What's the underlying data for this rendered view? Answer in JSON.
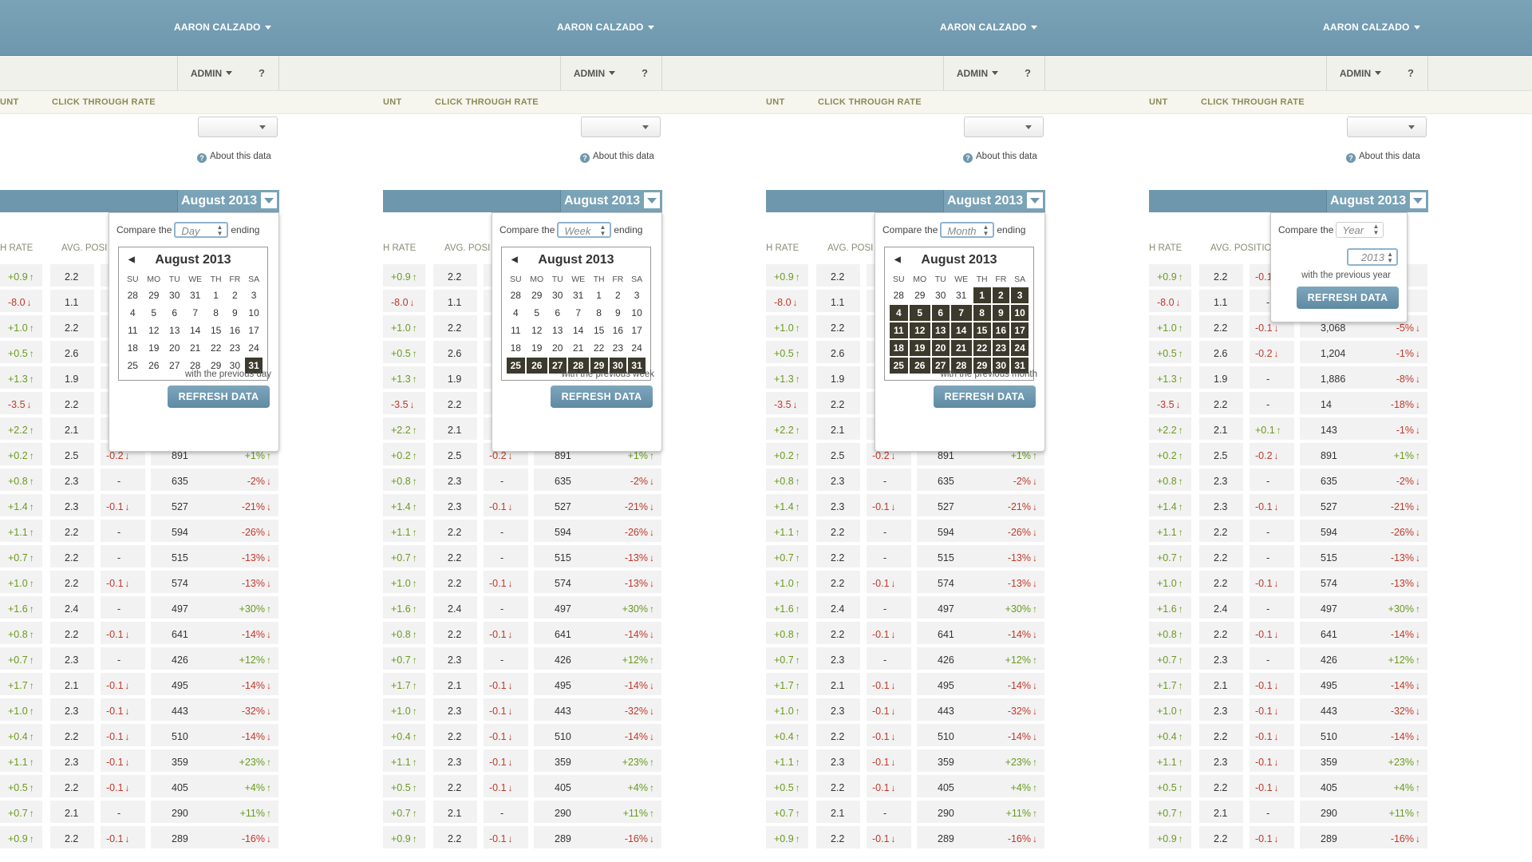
{
  "user_menu": "AARON CALZADO",
  "admin": "ADMIN",
  "help": "?",
  "col_count": "UNT",
  "col_ctr": "CLICK THROUGH RATE",
  "about": "About this data",
  "month_label": "August 2013",
  "compare_prefix": "Compare the",
  "compare_suffix": "ending",
  "sub_headers": {
    "rate": "H RATE",
    "pos": "AVG. POSI",
    "pos_full": "AVG. POSITION"
  },
  "calendar": {
    "title": "August 2013",
    "weekdays": [
      "SU",
      "MO",
      "TU",
      "WE",
      "TH",
      "FR",
      "SA"
    ],
    "weeks": [
      [
        28,
        29,
        30,
        31,
        1,
        2,
        3
      ],
      [
        4,
        5,
        6,
        7,
        8,
        9,
        10
      ],
      [
        11,
        12,
        13,
        14,
        15,
        16,
        17
      ],
      [
        18,
        19,
        20,
        21,
        22,
        23,
        24
      ],
      [
        25,
        26,
        27,
        28,
        29,
        30,
        31
      ]
    ]
  },
  "panels": [
    {
      "period": "Day",
      "with_previous": "with the previous day"
    },
    {
      "period": "Week",
      "with_previous": "with the previous week"
    },
    {
      "period": "Month",
      "with_previous": "with the previous month"
    },
    {
      "period": "Year",
      "year": "2013",
      "with_previous": "with the previous year"
    }
  ],
  "refresh": "REFRESH DATA",
  "rows": [
    {
      "rate": "+0.9",
      "pos": "2.2",
      "posch": "-0.1",
      "imp": "",
      "impch": ""
    },
    {
      "rate": "-8.0",
      "pos": "1.1",
      "posch": "-",
      "imp": "",
      "impch": ""
    },
    {
      "rate": "+1.0",
      "pos": "2.2",
      "posch": "-0.1",
      "imp": "3,068",
      "impch": "-5%"
    },
    {
      "rate": "+0.5",
      "pos": "2.6",
      "posch": "-0.2",
      "imp": "1,204",
      "impch": "-1%"
    },
    {
      "rate": "+1.3",
      "pos": "1.9",
      "posch": "-",
      "imp": "1,886",
      "impch": "-8%"
    },
    {
      "rate": "-3.5",
      "pos": "2.2",
      "posch": "-",
      "imp": "14",
      "impch": "-18%"
    },
    {
      "rate": "+2.2",
      "pos": "2.1",
      "posch": "+0.1",
      "imp": "143",
      "impch": "-1%"
    },
    {
      "rate": "+0.2",
      "pos": "2.5",
      "posch": "-0.2",
      "imp": "891",
      "impch": "+1%"
    },
    {
      "rate": "+0.8",
      "pos": "2.3",
      "posch": "-",
      "imp": "635",
      "impch": "-2%"
    },
    {
      "rate": "+1.4",
      "pos": "2.3",
      "posch": "-0.1",
      "imp": "527",
      "impch": "-21%"
    },
    {
      "rate": "+1.1",
      "pos": "2.2",
      "posch": "-",
      "imp": "594",
      "impch": "-26%"
    },
    {
      "rate": "+0.7",
      "pos": "2.2",
      "posch": "-",
      "imp": "515",
      "impch": "-13%"
    },
    {
      "rate": "+1.0",
      "pos": "2.2",
      "posch": "-0.1",
      "imp": "574",
      "impch": "-13%"
    },
    {
      "rate": "+1.6",
      "pos": "2.4",
      "posch": "-",
      "imp": "497",
      "impch": "+30%"
    },
    {
      "rate": "+0.8",
      "pos": "2.2",
      "posch": "-0.1",
      "imp": "641",
      "impch": "-14%"
    },
    {
      "rate": "+0.7",
      "pos": "2.3",
      "posch": "-",
      "imp": "426",
      "impch": "+12%"
    },
    {
      "rate": "+1.7",
      "pos": "2.1",
      "posch": "-0.1",
      "imp": "495",
      "impch": "-14%"
    },
    {
      "rate": "+1.0",
      "pos": "2.3",
      "posch": "-0.1",
      "imp": "443",
      "impch": "-32%"
    },
    {
      "rate": "+0.4",
      "pos": "2.2",
      "posch": "-0.1",
      "imp": "510",
      "impch": "-14%"
    },
    {
      "rate": "+1.1",
      "pos": "2.3",
      "posch": "-0.1",
      "imp": "359",
      "impch": "+23%"
    },
    {
      "rate": "+0.5",
      "pos": "2.2",
      "posch": "-0.1",
      "imp": "405",
      "impch": "+4%"
    },
    {
      "rate": "+0.7",
      "pos": "2.1",
      "posch": "-",
      "imp": "290",
      "impch": "+11%"
    },
    {
      "rate": "+0.9",
      "pos": "2.2",
      "posch": "-0.1",
      "imp": "289",
      "impch": "-16%"
    }
  ],
  "colors": {
    "accent": "#6e97ad",
    "positive": "#6a9a1e",
    "negative": "#c0392b",
    "selected_day": "#3b3a2c"
  }
}
